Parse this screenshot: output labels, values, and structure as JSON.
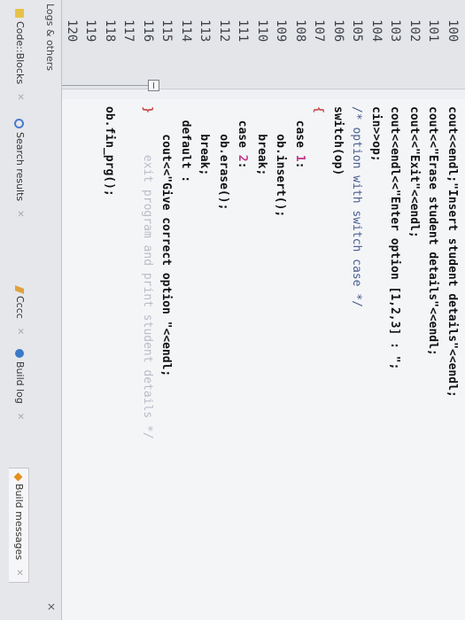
{
  "line_numbers": [
    "100",
    "101",
    "102",
    "103",
    "104",
    "105",
    "106",
    "107",
    "108",
    "109",
    "110",
    "111",
    "112",
    "113",
    "114",
    "115",
    "116",
    "117",
    "118",
    "119",
    "120"
  ],
  "code_lines": [
    {
      "parts": [
        {
          "t": "cout<<endl;\"Insert student details\"<<endl;",
          "c": ""
        }
      ]
    },
    {
      "parts": [
        {
          "t": "cout<<\"Erase student details\"<<endl;",
          "c": ""
        }
      ]
    },
    {
      "parts": [
        {
          "t": "cout<<\"Exit\"<<endl;",
          "c": ""
        }
      ]
    },
    {
      "parts": [
        {
          "t": "cout<<endl<<\"Enter option [1,2,3] : \";",
          "c": ""
        }
      ]
    },
    {
      "parts": [
        {
          "t": "cin>>op;",
          "c": ""
        }
      ]
    },
    {
      "parts": [
        {
          "t": "/* option with switch case */",
          "c": "cmt"
        }
      ]
    },
    {
      "parts": [
        {
          "t": "switch(op)",
          "c": ""
        }
      ]
    },
    {
      "parts": [
        {
          "t": "{",
          "c": "brace"
        }
      ]
    },
    {
      "parts": [
        {
          "t": "  case ",
          "c": ""
        },
        {
          "t": "1",
          "c": "num"
        },
        {
          "t": ":",
          "c": ""
        }
      ]
    },
    {
      "parts": [
        {
          "t": "    ob.insert();",
          "c": ""
        }
      ]
    },
    {
      "parts": [
        {
          "t": "    break;",
          "c": ""
        }
      ]
    },
    {
      "parts": [
        {
          "t": "  case ",
          "c": ""
        },
        {
          "t": "2",
          "c": "num"
        },
        {
          "t": ":",
          "c": ""
        }
      ]
    },
    {
      "parts": [
        {
          "t": "    ob.erase();",
          "c": ""
        }
      ]
    },
    {
      "parts": [
        {
          "t": "    break;",
          "c": ""
        }
      ]
    },
    {
      "parts": [
        {
          "t": "  default :",
          "c": ""
        }
      ]
    },
    {
      "parts": [
        {
          "t": "    cout<<\"Give correct option \"<<endl;",
          "c": ""
        }
      ]
    },
    {
      "parts": [
        {
          "t": "}",
          "c": "brace"
        },
        {
          "t": "      exit program and print student details */",
          "c": "faint"
        }
      ]
    },
    {
      "parts": [
        {
          "t": " ",
          "c": ""
        }
      ]
    },
    {
      "parts": [
        {
          "t": "ob.fin_prg();",
          "c": ""
        }
      ]
    },
    {
      "parts": [
        {
          "t": " ",
          "c": ""
        }
      ]
    },
    {
      "parts": [
        {
          "t": " ",
          "c": ""
        }
      ]
    }
  ],
  "logs_panel": {
    "title": "Logs & others",
    "close": "×",
    "tabs": [
      {
        "label": "Code::Blocks",
        "icon": "book-icon"
      },
      {
        "label": "Search results",
        "icon": "search-icon"
      },
      {
        "label": "Cccc",
        "icon": "pencil-icon"
      },
      {
        "label": "Build log",
        "icon": "gear-icon"
      },
      {
        "label": "Build messages",
        "icon": "diamond-icon"
      }
    ]
  }
}
